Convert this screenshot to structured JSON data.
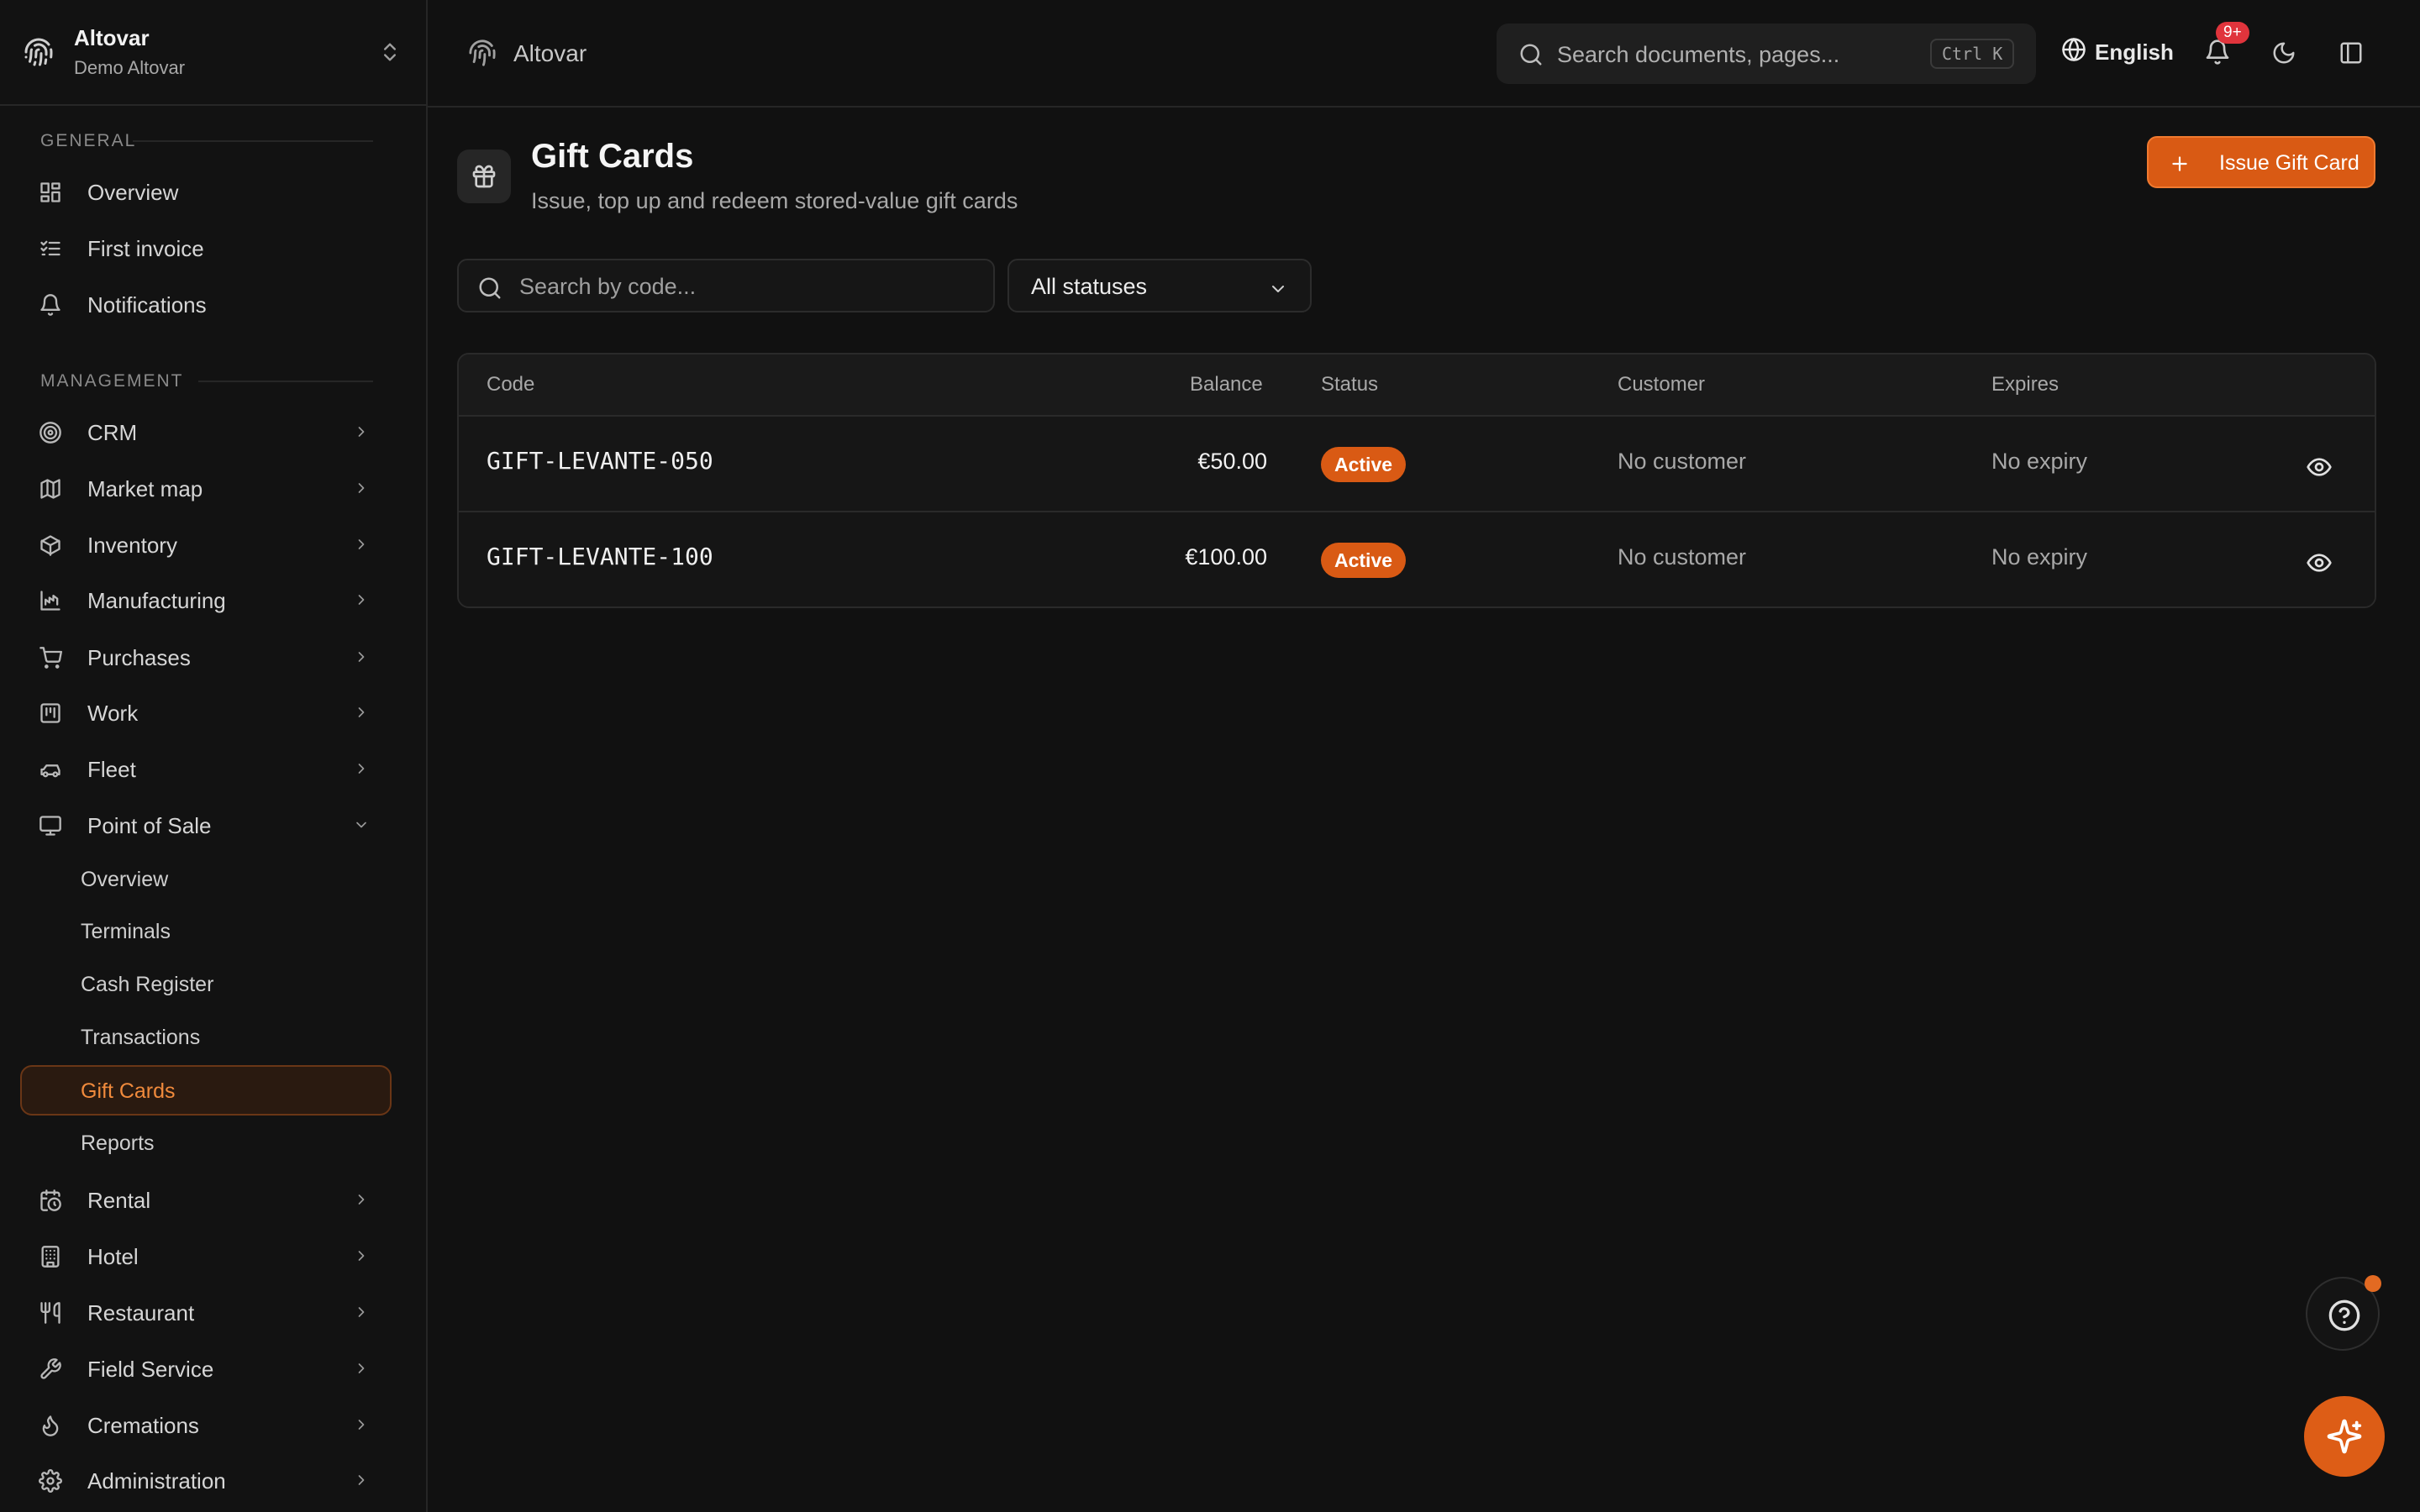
{
  "org": {
    "name": "Altovar",
    "subtitle": "Demo Altovar"
  },
  "sidebar": {
    "general_label": "GENERAL",
    "general": [
      {
        "label": "Overview",
        "icon": "dashboard-icon"
      },
      {
        "label": "First invoice",
        "icon": "checklist-icon"
      },
      {
        "label": "Notifications",
        "icon": "bell-icon"
      }
    ],
    "management_label": "MANAGEMENT",
    "management": [
      {
        "label": "CRM",
        "icon": "target-icon"
      },
      {
        "label": "Market map",
        "icon": "map-icon"
      },
      {
        "label": "Inventory",
        "icon": "box-icon"
      },
      {
        "label": "Manufacturing",
        "icon": "factory-icon"
      },
      {
        "label": "Purchases",
        "icon": "cart-icon"
      },
      {
        "label": "Work",
        "icon": "kanban-icon"
      },
      {
        "label": "Fleet",
        "icon": "car-icon"
      },
      {
        "label": "Point of Sale",
        "icon": "monitor-icon"
      }
    ],
    "pos_items": [
      "Overview",
      "Terminals",
      "Cash Register",
      "Transactions",
      "Gift Cards",
      "Reports"
    ],
    "active_item": "Gift Cards",
    "more": [
      {
        "label": "Rental",
        "icon": "calendar-clock-icon"
      },
      {
        "label": "Hotel",
        "icon": "building-icon"
      },
      {
        "label": "Restaurant",
        "icon": "utensils-icon"
      },
      {
        "label": "Field Service",
        "icon": "wrench-icon"
      },
      {
        "label": "Cremations",
        "icon": "flame-icon"
      },
      {
        "label": "Administration",
        "icon": "gear-icon"
      }
    ]
  },
  "topbar": {
    "breadcrumb": "Altovar",
    "search_placeholder": "Search documents, pages...",
    "shortcut": "Ctrl K",
    "language": "English",
    "notification_count": "9+"
  },
  "page": {
    "title": "Gift Cards",
    "subtitle": "Issue, top up and redeem stored-value gift cards",
    "issue_button": "Issue Gift Card",
    "search_placeholder": "Search by code...",
    "status_filter": "All statuses"
  },
  "table": {
    "headers": {
      "code": "Code",
      "balance": "Balance",
      "status": "Status",
      "customer": "Customer",
      "expires": "Expires"
    },
    "rows": [
      {
        "code": "GIFT-LEVANTE-050",
        "balance": "€50.00",
        "status": "Active",
        "customer": "No customer",
        "expires": "No expiry"
      },
      {
        "code": "GIFT-LEVANTE-100",
        "balance": "€100.00",
        "status": "Active",
        "customer": "No customer",
        "expires": "No expiry"
      }
    ]
  },
  "colors": {
    "accent": "#d95a14",
    "background": "#111111",
    "badge": "#e0343c"
  }
}
